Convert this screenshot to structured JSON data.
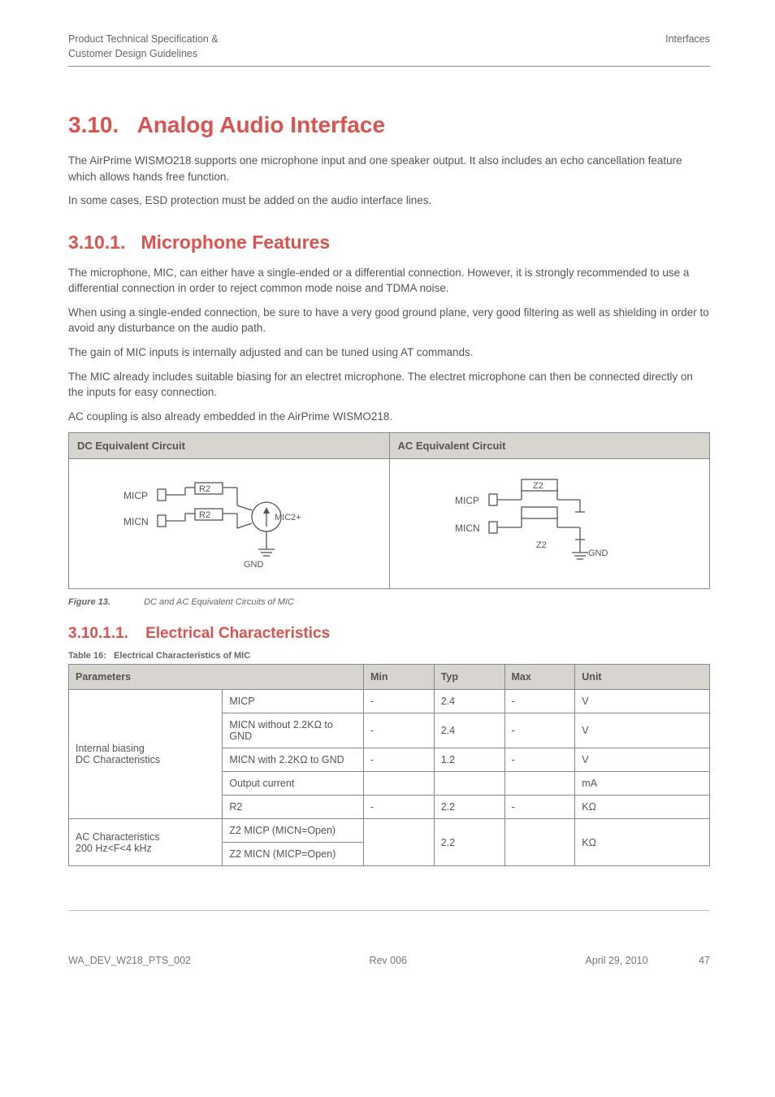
{
  "header": {
    "left_line1": "Product Technical Specification &",
    "left_line2": "Customer Design Guidelines",
    "right": "Interfaces"
  },
  "h1_num": "3.10.",
  "h1_title": "Analog Audio Interface",
  "p1": "The AirPrime WISMO218 supports one microphone input and one speaker output. It also includes an echo cancellation feature which allows hands free function.",
  "p2": "In some cases, ESD protection must be added on the audio interface lines.",
  "h2_num": "3.10.1.",
  "h2_title": "Microphone Features",
  "p3": "The microphone, MIC, can either have a single-ended or a differential connection. However, it is strongly recommended to use a differential connection in order to reject common mode noise and TDMA noise.",
  "p4": "When using a single-ended connection, be sure to have a very good ground plane, very good filtering as well as shielding in order to avoid any disturbance on the audio path.",
  "p5": "The gain of MIC inputs is internally adjusted and can be tuned using AT commands.",
  "p6": "The MIC already includes suitable biasing for an electret microphone. The electret microphone can then be connected directly on the inputs for easy connection.",
  "p7": "AC coupling is also already embedded in the AirPrime WISMO218.",
  "eqv": {
    "dc_header": "DC Equivalent Circuit",
    "ac_header": "AC Equivalent Circuit",
    "dc": {
      "micp": "MICP",
      "micn": "MICN",
      "r2a": "R2",
      "r2b": "R2",
      "mic2plus": "MIC2+",
      "gnd": "GND"
    },
    "ac": {
      "micp": "MICP",
      "micn": "MICN",
      "z2a": "Z2",
      "z2b": "Z2",
      "gnd": "GND"
    }
  },
  "fig13_label": "Figure 13.",
  "fig13_title": "DC and AC Equivalent Circuits of MIC",
  "h3_num": "3.10.1.1.",
  "h3_title": "Electrical Characteristics",
  "tab16_label": "Table 16:",
  "tab16_title": "Electrical Characteristics of MIC",
  "params": {
    "head": {
      "parameters": "Parameters",
      "min": "Min",
      "typ": "Typ",
      "max": "Max",
      "unit": "Unit"
    },
    "group_dc": "Internal biasing\nDC Characteristics",
    "group_ac": "AC Characteristics\n200 Hz<F<4 kHz",
    "rows_dc": [
      {
        "p": "MICP",
        "min": "-",
        "typ": "2.4",
        "max": "-",
        "unit": "V"
      },
      {
        "p": "MICN without 2.2KΩ to GND",
        "min": "-",
        "typ": "2.4",
        "max": "-",
        "unit": "V"
      },
      {
        "p": "MICN with 2.2KΩ to GND",
        "min": "-",
        "typ": "1.2",
        "max": "-",
        "unit": "V"
      },
      {
        "p": "Output current",
        "min": "",
        "typ": "",
        "max": "",
        "unit": "mA"
      },
      {
        "p": "R2",
        "min": "-",
        "typ": "2.2",
        "max": "-",
        "unit": "KΩ"
      }
    ],
    "rows_ac": [
      {
        "p": "Z2  MICP (MICN=Open)"
      },
      {
        "p": "Z2  MICN (MICP=Open)"
      }
    ],
    "ac_shared": {
      "min": "",
      "typ": "2.2",
      "max": "",
      "unit": "KΩ"
    }
  },
  "footer": {
    "left": "WA_DEV_W218_PTS_002",
    "mid": "Rev 006",
    "date": "April 29, 2010",
    "page": "47"
  }
}
